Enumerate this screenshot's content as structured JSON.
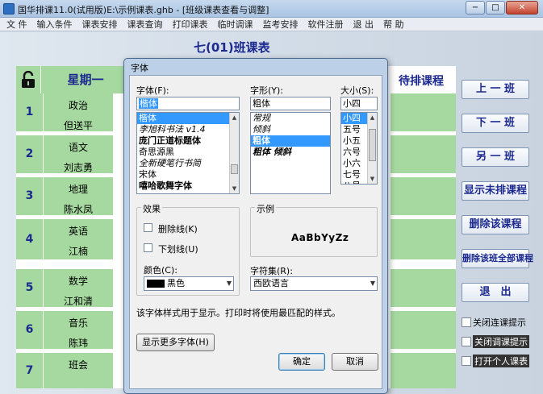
{
  "window": {
    "title": "国华排课11.0(试用版)E:\\示例课表.ghb - [班级课表查看与调整]",
    "buttons": {
      "minimize": "−",
      "maximize": "□",
      "close": "✕"
    }
  },
  "menu": [
    "文 件",
    "输入条件",
    "课表安排",
    "课表查询",
    "打印课表",
    "临时调课",
    "监考安排",
    "软件注册",
    "退 出",
    "帮 助"
  ],
  "class_title": "七(01)班课表",
  "timetable": {
    "weekday_header": "星期一",
    "pending_header": "待排课程",
    "rows": [
      {
        "period": "1",
        "course": "政治",
        "teacher": "但送平"
      },
      {
        "period": "2",
        "course": "语文",
        "teacher": "刘志勇"
      },
      {
        "period": "3",
        "course": "地理",
        "teacher": "陈水凤"
      },
      {
        "period": "4",
        "course": "英语",
        "teacher": "江楠"
      },
      {
        "period": "5",
        "course": "数学",
        "teacher": "江和清"
      },
      {
        "period": "6",
        "course": "音乐",
        "teacher": "陈玮"
      },
      {
        "period": "7",
        "course": "班会",
        "teacher": ""
      }
    ]
  },
  "right_panel": {
    "prev_class": "上 一 班",
    "next_class": "下 一 班",
    "other_class": "另 一 班",
    "show_unscheduled": "显示未排课程",
    "delete_course": "删除该课程",
    "delete_all": "删除该班全部课程",
    "exit": "退　出",
    "checkboxes": [
      "关闭连课提示",
      "关闭调课提示",
      "打开个人课表"
    ]
  },
  "font_dialog": {
    "title": "字体",
    "font_label": "字体(F):",
    "font_value": "楷体",
    "font_list": [
      "楷体",
      "李旭科书法 v1.4",
      "庞门正道标题体",
      "奇思源黑",
      "全新硬笔行书简",
      "宋体",
      "嘻哈歌舞字体"
    ],
    "style_label": "字形(Y):",
    "style_value": "粗体",
    "style_list": [
      "常规",
      "倾斜",
      "粗体",
      "粗体 倾斜"
    ],
    "size_label": "大小(S):",
    "size_value": "小四",
    "size_list": [
      "小四",
      "五号",
      "小五",
      "六号",
      "小六",
      "七号",
      "八号"
    ],
    "effects_label": "效果",
    "strikeout_label": "删除线(K)",
    "underline_label": "下划线(U)",
    "color_label": "颜色(C):",
    "color_value": "黑色",
    "sample_label": "示例",
    "sample_text": "AaBbYyZz",
    "charset_label": "字符集(R):",
    "charset_value": "西欧语言",
    "info_text": "该字体样式用于显示。打印时将使用最匹配的样式。",
    "more_fonts": "显示更多字体(H)",
    "ok": "确定",
    "cancel": "取消"
  },
  "colors": {
    "cell_green": "#a6d9a0",
    "header_blue": "#1c2a8f",
    "selection": "#3399ff"
  }
}
